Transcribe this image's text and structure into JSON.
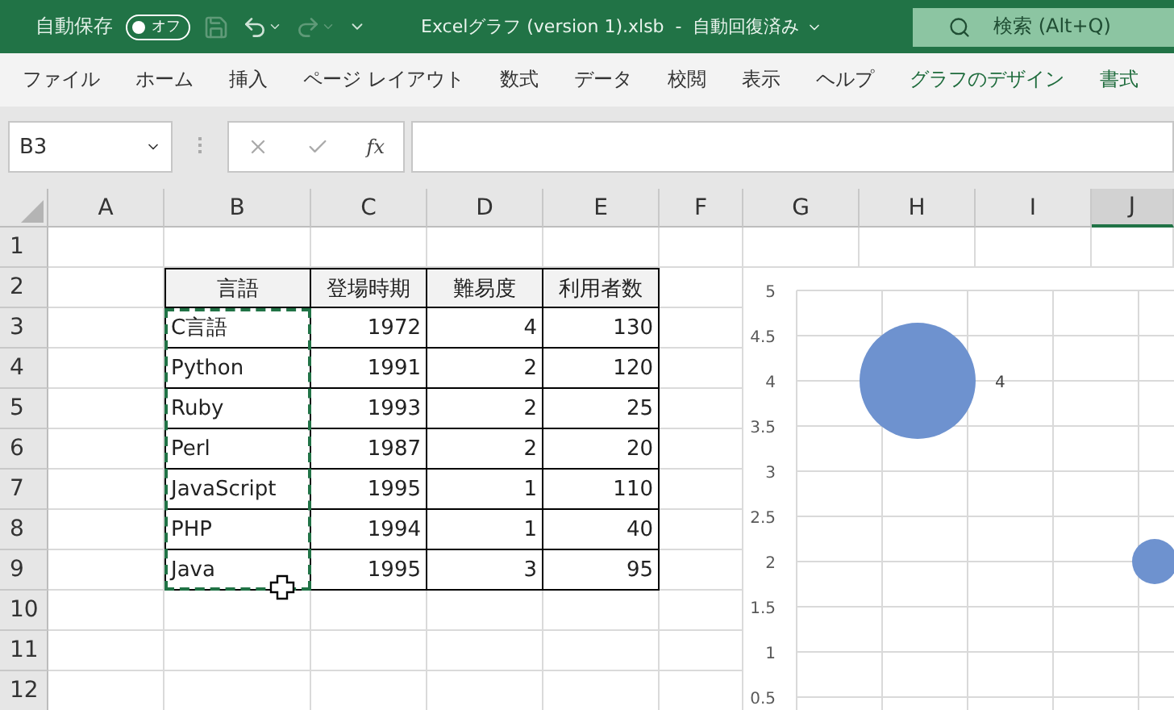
{
  "title_bar": {
    "autosave_label": "自動保存",
    "autosave_toggle": {
      "on": false,
      "label": "オフ"
    },
    "redo_disabled": true,
    "title": "Excelグラフ (version 1).xlsb  -  自動回復済み",
    "search": {
      "placeholder": "検索 (Alt+Q)"
    }
  },
  "ribbon_tabs": [
    {
      "label": "ファイル",
      "kind": "normal"
    },
    {
      "label": "ホーム",
      "kind": "normal"
    },
    {
      "label": "挿入",
      "kind": "normal"
    },
    {
      "label": "ページ レイアウト",
      "kind": "normal"
    },
    {
      "label": "数式",
      "kind": "normal"
    },
    {
      "label": "データ",
      "kind": "normal"
    },
    {
      "label": "校閲",
      "kind": "normal"
    },
    {
      "label": "表示",
      "kind": "normal"
    },
    {
      "label": "ヘルプ",
      "kind": "normal"
    },
    {
      "label": "グラフのデザイン",
      "kind": "contextual"
    },
    {
      "label": "書式",
      "kind": "contextual"
    }
  ],
  "formula_bar": {
    "name_box": "B3",
    "function_label": "fx"
  },
  "sheet": {
    "columns": [
      {
        "label": "A",
        "selected": false
      },
      {
        "label": "B",
        "selected": false
      },
      {
        "label": "C",
        "selected": false
      },
      {
        "label": "D",
        "selected": false
      },
      {
        "label": "E",
        "selected": false
      },
      {
        "label": "F",
        "selected": false
      },
      {
        "label": "G",
        "selected": false
      },
      {
        "label": "H",
        "selected": false
      },
      {
        "label": "I",
        "selected": false
      },
      {
        "label": "J",
        "selected": true
      }
    ],
    "rows": [
      "1",
      "2",
      "3",
      "4",
      "5",
      "6",
      "7",
      "8",
      "9",
      "10",
      "11",
      "12"
    ],
    "table": {
      "header": [
        "言語",
        "登場時期",
        "難易度",
        "利用者数"
      ],
      "rows": [
        [
          "C言語",
          "1972",
          "4",
          "130"
        ],
        [
          "Python",
          "1991",
          "2",
          "120"
        ],
        [
          "Ruby",
          "1993",
          "2",
          "25"
        ],
        [
          "Perl",
          "1987",
          "2",
          "20"
        ],
        [
          "JavaScript",
          "1995",
          "1",
          "110"
        ],
        [
          "PHP",
          "1994",
          "1",
          "40"
        ],
        [
          "Java",
          "1995",
          "3",
          "95"
        ]
      ],
      "first_column_marquee": true
    }
  },
  "chart": {
    "chart_data": {
      "type": "scatter",
      "yticks": [
        0.5,
        1,
        1.5,
        2,
        2.5,
        3,
        3.5,
        4,
        4.5,
        5
      ],
      "ylim": [
        0.5,
        5
      ],
      "grid": true,
      "series": [
        {
          "color": "#6e92cf",
          "values": [
            4,
            2
          ]
        }
      ],
      "value_labels": [
        "4",
        null
      ]
    }
  }
}
